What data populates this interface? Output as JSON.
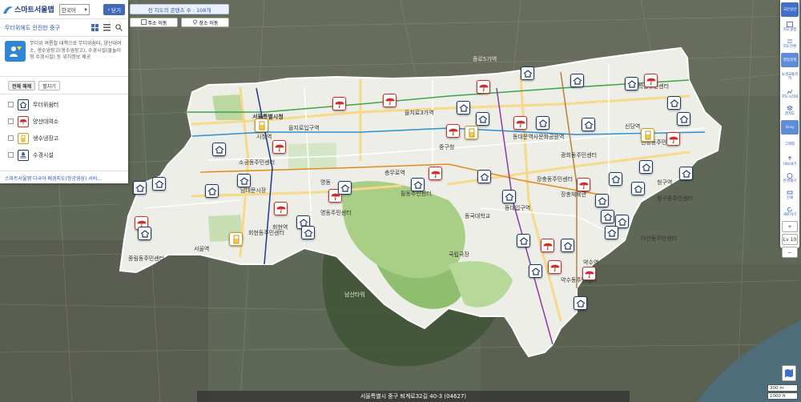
{
  "app": {
    "logo_text": "스마트서울맵",
    "language": "한국어",
    "close_label": "닫기"
  },
  "panel": {
    "title": "무더위에도 안전한 중구",
    "description": "무더위 여름철 대책으로 무더위쉼터, 양산대여소, 생수냉장고(생수냉장고), 수경시설(물놀이형 수경시설) 등 위치정보 제공",
    "tabs": [
      "전체 해제",
      "펼치기"
    ],
    "layers": [
      {
        "label": "무더위쉼터",
        "icon": "shelter-icon"
      },
      {
        "label": "양산대여소",
        "icon": "umbrella-icon"
      },
      {
        "label": "생수냉장고",
        "icon": "water-bottle-icon"
      },
      {
        "label": "수경시설",
        "icon": "fountain-icon"
      }
    ],
    "footer": "스마트서울맵 다국어 배경지도(항공영상) 서비..."
  },
  "top_bar": {
    "content_count": "전 지도의 콘텐츠 수 : 108개",
    "address_button": "주소 이동",
    "place_button": "장소 이동"
  },
  "right_toolbar": {
    "buttons": [
      "국문일반",
      "지도설정",
      "지도전환",
      "행정경계",
      "녹색교통지역",
      "지도시각화",
      "겹지도",
      "Gray",
      "그래픽",
      "내보내기",
      "반경재기",
      "인쇄",
      "새로하기"
    ],
    "zoom_in": "+",
    "zoom_out": "−",
    "zoom_level": "Lv 10"
  },
  "map": {
    "labels": [
      "서울특별시청",
      "을지로3가역",
      "동대문역사문화공원역",
      "명동",
      "서울역",
      "중구청",
      "을지로입구역",
      "약수역",
      "신당역",
      "청구역",
      "남산타워",
      "국립극장",
      "동국대학교",
      "장충체육관",
      "충무로역",
      "남대문시장",
      "회현역",
      "시청역",
      "종로5가역",
      "동대입구역",
      "다산동주민센터",
      "약수동주민센터",
      "중림동주민센터",
      "명동주민센터",
      "필동주민센터",
      "광희동주민센터",
      "청구동주민센터",
      "황학동주민센터",
      "신당동주민센터",
      "장충동주민센터",
      "회현동주민센터",
      "소공동주민센터"
    ]
  },
  "bottom": {
    "address": "서울특별시 중구 퇴계로32길 40-3 (04627)",
    "scale_300": "300 m",
    "scale_1000": "1000 ft"
  }
}
